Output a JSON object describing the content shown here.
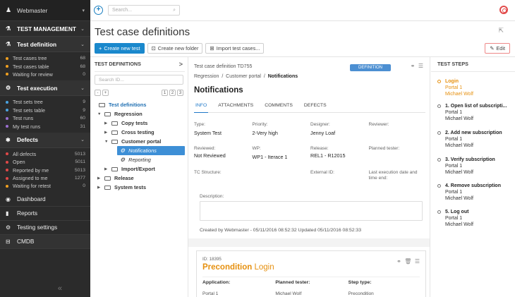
{
  "sidebar": {
    "user": "Webmaster",
    "sections": {
      "test_management": "TEST MANAGEMENT",
      "test_definition": "Test definition",
      "test_execution": "Test execution",
      "defects": "Defects"
    },
    "test_definition_items": [
      {
        "label": "Test cases tree",
        "count": "68",
        "color": "#f0a020"
      },
      {
        "label": "Test cases table",
        "count": "68",
        "color": "#f0a020"
      },
      {
        "label": "Waiting for review",
        "count": "0",
        "color": "#f0a020"
      }
    ],
    "test_execution_items": [
      {
        "label": "Test sets tree",
        "count": "9",
        "color": "#4aa3e0"
      },
      {
        "label": "Test sets table",
        "count": "9",
        "color": "#4aa3e0"
      },
      {
        "label": "Test runs",
        "count": "60",
        "color": "#9b6fd0"
      },
      {
        "label": "My test runs",
        "count": "31",
        "color": "#9b6fd0"
      }
    ],
    "defects_items": [
      {
        "label": "All defects",
        "count": "5013",
        "color": "#e04848"
      },
      {
        "label": "Open",
        "count": "5011",
        "color": "#e04848"
      },
      {
        "label": "Reported by me",
        "count": "5013",
        "color": "#e04848"
      },
      {
        "label": "Assigned to me",
        "count": "1277",
        "color": "#e04848"
      },
      {
        "label": "Waiting for retest",
        "count": "0",
        "color": "#f0a020"
      }
    ],
    "links": {
      "dashboard": "Dashboard",
      "reports": "Reports",
      "testing_settings": "Testing settings",
      "cmdb": "CMDB"
    }
  },
  "topbar": {
    "search_placeholder": "Search..."
  },
  "page": {
    "title": "Test case definitions",
    "buttons": {
      "create_test": "Create new test",
      "create_folder": "Create new folder",
      "import": "Import test cases...",
      "edit": "Edit"
    }
  },
  "tree": {
    "header": "TEST DEFINITIONS",
    "search_placeholder": "Search ID...",
    "levels": [
      "1",
      "2",
      "3"
    ],
    "nodes": {
      "root": "Test definitions",
      "regression": "Regression",
      "copy_tests": "Copy tests",
      "cross_testing": "Cross testing",
      "customer_portal": "Customer portal",
      "notifications": "Notifications",
      "reporting": "Reporting",
      "import_export": "Import/Export",
      "release": "Release",
      "system_tests": "System tests"
    }
  },
  "detail": {
    "crumb_id": "Test case definition TD755",
    "badge": "DEFINITION",
    "path1": "Regression",
    "path2": "Customer portal",
    "path3": "Notifications",
    "title": "Notifications",
    "tabs": [
      "INFO",
      "ATTACHMENTS",
      "COMMENTS",
      "DEFECTS"
    ],
    "fields": {
      "type_label": "Type:",
      "type_value": "System Test",
      "priority_label": "Priority:",
      "priority_value": "2-Very high",
      "designer_label": "Designer:",
      "designer_value": "Jenny Loaf",
      "reviewer_label": "Reviewer:",
      "reviewed_label": "Reviewed:",
      "reviewed_value": "Not Reviewed",
      "wp_label": "WP:",
      "wp_value": "WP1 - Iterace 1",
      "release_label": "Release:",
      "release_value": "REL1 - R12015",
      "planned_tester_label": "Planned tester:",
      "tc_structure_label": "TC Structure:",
      "external_id_label": "External ID:",
      "last_exec_label": "Last execution date and time end:"
    },
    "description_label": "Description:",
    "created_text": "Created by Webmaster - 05/11/2016 08:52:32   Updated 05/11/2016 08:52:33"
  },
  "precondition": {
    "id": "ID: 18395",
    "title_a": "Precondition",
    "title_b": "Login",
    "col_application": "Application:",
    "col_planned_tester": "Planned tester:",
    "col_step_type": "Step type:",
    "val_application": "Portal 1",
    "val_planned_tester": "Michael Wolf",
    "val_step_type": "Precondition"
  },
  "steps": {
    "header": "TEST STEPS",
    "items": [
      {
        "title": "Login",
        "app": "Portal 1",
        "tester": "Michael Wolf"
      },
      {
        "title": "1. Open list of subscripti...",
        "app": "Portal 1",
        "tester": "Michael Wolf"
      },
      {
        "title": "2. Add new subscription",
        "app": "Portal 1",
        "tester": "Michael Wolf"
      },
      {
        "title": "3. Verify subscription",
        "app": "Portal 1",
        "tester": "Michael Wolf"
      },
      {
        "title": "4. Remove subscription",
        "app": "Portal 1",
        "tester": "Michael Wolf"
      },
      {
        "title": "5. Log out",
        "app": "Portal 1",
        "tester": "Michael Wolf"
      }
    ]
  }
}
